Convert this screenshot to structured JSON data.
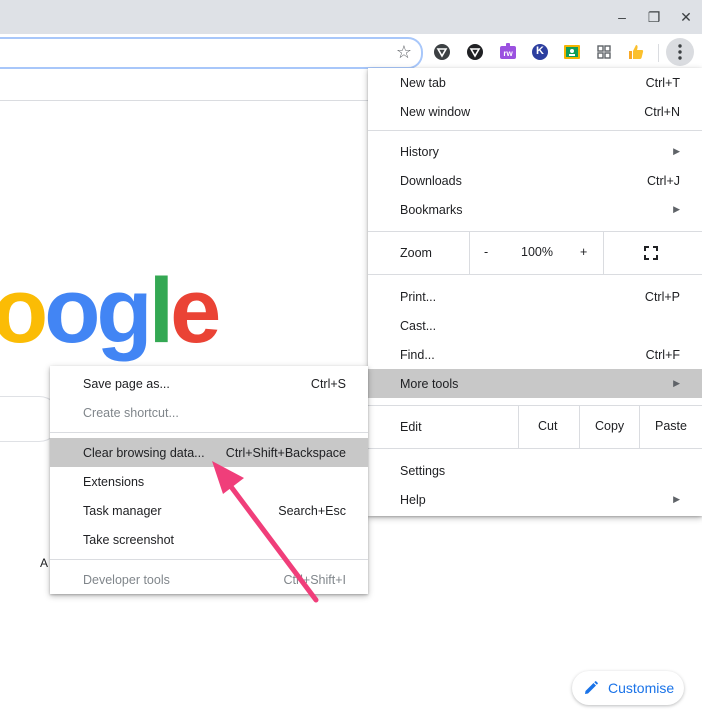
{
  "window": {
    "minimize_glyph": "–",
    "maximize_glyph": "❐",
    "close_glyph": "✕"
  },
  "toolbar": {
    "extensions": [
      "shield-v-icon",
      "shield-v-dark-icon",
      "puzzle-rw-icon",
      "k-icon",
      "classroom-icon",
      "grid-icon",
      "thumbs-up-icon"
    ],
    "extension_labels": {
      "rw": "rw",
      "k": "K"
    }
  },
  "page": {
    "logo_letters": [
      {
        "ch": "o",
        "color": "#FBBC05"
      },
      {
        "ch": "o",
        "color": "#4285F4"
      },
      {
        "ch": "g",
        "color": "#4285F4"
      },
      {
        "ch": "l",
        "color": "#34A853"
      },
      {
        "ch": "e",
        "color": "#EA4335"
      }
    ],
    "shortcut_fragment": "A",
    "customise_label": "Customise"
  },
  "main_menu": {
    "new_tab": {
      "label": "New tab",
      "shortcut": "Ctrl+T"
    },
    "new_window": {
      "label": "New window",
      "shortcut": "Ctrl+N"
    },
    "history": {
      "label": "History"
    },
    "downloads": {
      "label": "Downloads",
      "shortcut": "Ctrl+J"
    },
    "bookmarks": {
      "label": "Bookmarks"
    },
    "zoom": {
      "label": "Zoom",
      "minus": "-",
      "value": "100%",
      "plus": "+"
    },
    "print": {
      "label": "Print...",
      "shortcut": "Ctrl+P"
    },
    "cast": {
      "label": "Cast..."
    },
    "find": {
      "label": "Find...",
      "shortcut": "Ctrl+F"
    },
    "more_tools": {
      "label": "More tools"
    },
    "edit": {
      "label": "Edit",
      "cut": "Cut",
      "copy": "Copy",
      "paste": "Paste"
    },
    "settings": {
      "label": "Settings"
    },
    "help": {
      "label": "Help"
    }
  },
  "sub_menu": {
    "save_page": {
      "label": "Save page as...",
      "shortcut": "Ctrl+S"
    },
    "create_shortcut": {
      "label": "Create shortcut..."
    },
    "clear_browsing": {
      "label": "Clear browsing data...",
      "shortcut": "Ctrl+Shift+Backspace"
    },
    "extensions": {
      "label": "Extensions"
    },
    "task_manager": {
      "label": "Task manager",
      "shortcut": "Search+Esc"
    },
    "take_screenshot": {
      "label": "Take screenshot"
    },
    "developer_tools": {
      "label": "Developer tools",
      "shortcut": "Ctrl+Shift+I"
    }
  },
  "colors": {
    "highlight": "#c8c8c8",
    "accent": "#1a73e8",
    "annotation_arrow": "#f03e7a"
  }
}
